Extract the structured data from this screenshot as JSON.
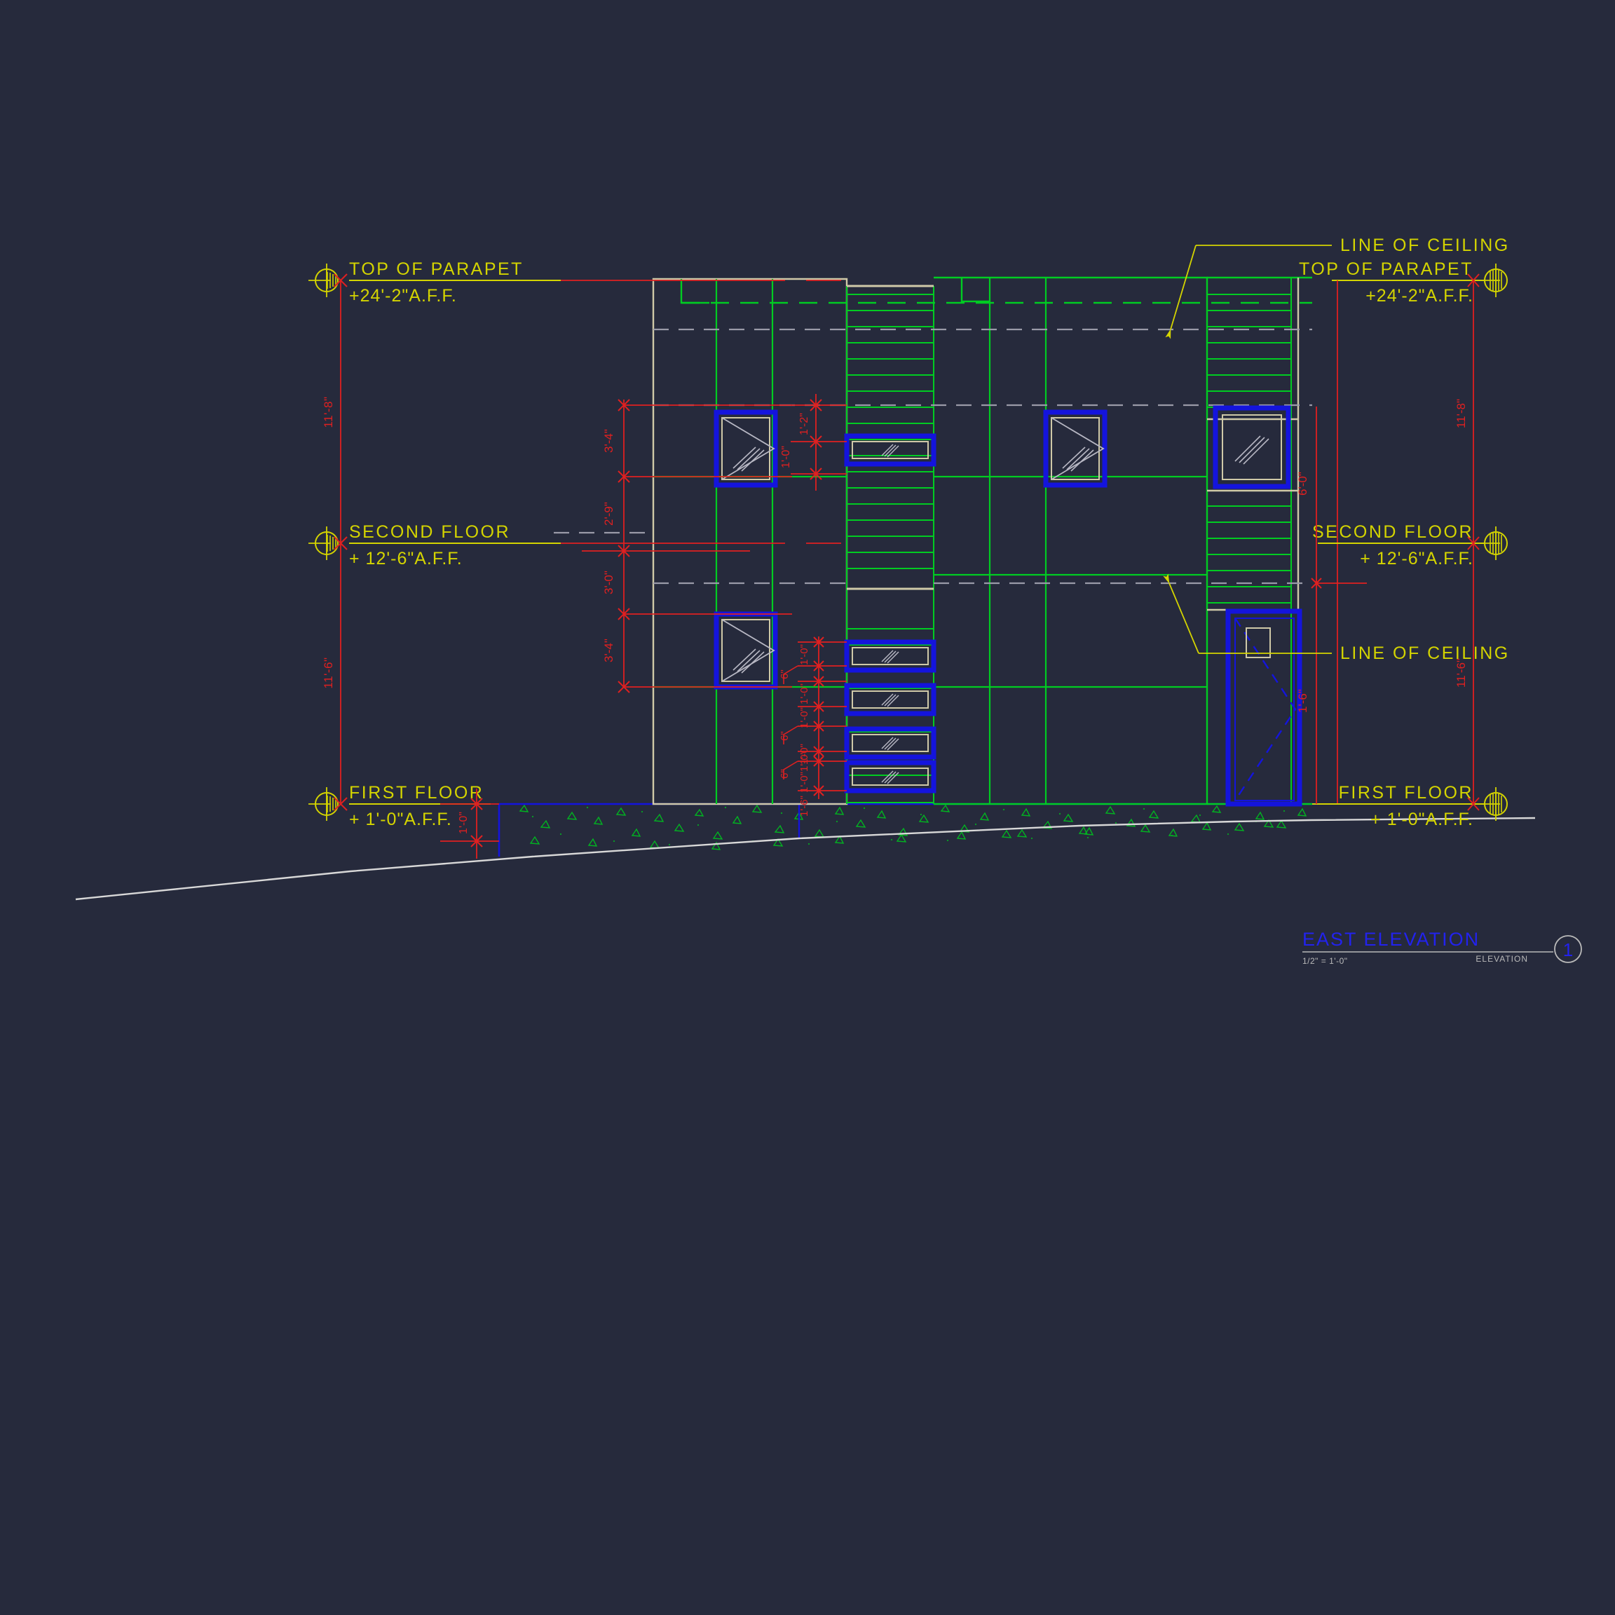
{
  "drawing": {
    "type": "architectural-elevation",
    "background_color": "#262a3c",
    "title_block": {
      "title": "EAST ELEVATION",
      "scale": "1/2\" = 1'-0\"",
      "sheet_ref_label": "ELEVATION",
      "detail_number": "1",
      "title_color": "#2222ee",
      "rule_color": "#b9b9b9"
    }
  },
  "colors": {
    "level_text": "#d4d400",
    "dimension": "#e02020",
    "siding": "#00cc22",
    "ceiling_dash": "#9a9aa8",
    "wall_outline": "#cfc9a8",
    "window_frame": "#1414dd",
    "grade_line": "#d8d8d8",
    "earth_hatch": "#00cc22"
  },
  "levels": {
    "left": [
      {
        "name": "TOP OF PARAPET",
        "elevation": "+24'-2\"A.F.F."
      },
      {
        "name": "SECOND FLOOR",
        "elevation": "+ 12'-6\"A.F.F."
      },
      {
        "name": "FIRST FLOOR",
        "elevation": "+ 1'-0\"A.F.F."
      }
    ],
    "right": [
      {
        "name": "TOP OF PARAPET",
        "elevation": "+24'-2\"A.F.F."
      },
      {
        "name": "SECOND FLOOR",
        "elevation": "+ 12'-6\"A.F.F."
      },
      {
        "name": "FIRST FLOOR",
        "elevation": "+ 1'-0\"A.F.F."
      }
    ]
  },
  "annotations": [
    {
      "id": "line-of-ceiling-upper",
      "text": "LINE OF CEILING"
    },
    {
      "id": "line-of-ceiling-lower",
      "text": "LINE OF CEILING"
    }
  ],
  "dimensions": {
    "left_story_heights": [
      {
        "value": "11'-8\""
      },
      {
        "value": "11'-6\""
      }
    ],
    "right_story_heights": [
      {
        "value": "11'-8\""
      },
      {
        "value": "11'-6\""
      }
    ],
    "left_window_chain": [
      {
        "value": "3'-4\""
      },
      {
        "value": "2'-9\""
      },
      {
        "value": "3'-0\""
      },
      {
        "value": "3'-4\""
      }
    ],
    "center_upper_chain": [
      {
        "value": "1'-2\""
      },
      {
        "value": "1'-0\""
      }
    ],
    "center_lower_chain": [
      {
        "value": "1'-0\""
      },
      {
        "value": "6\""
      },
      {
        "value": "1'-0\""
      },
      {
        "value": "1'-0\""
      },
      {
        "value": "6\""
      },
      {
        "value": "1'-0\""
      },
      {
        "value": "1'-0\""
      },
      {
        "value": "6\""
      },
      {
        "value": "1'-0\""
      },
      {
        "value": "1'-6\""
      }
    ],
    "right_chain": [
      {
        "value": "6'-0\""
      },
      {
        "value": "1'-6\""
      }
    ],
    "first_floor_offset": {
      "value": "1'-0\""
    }
  }
}
